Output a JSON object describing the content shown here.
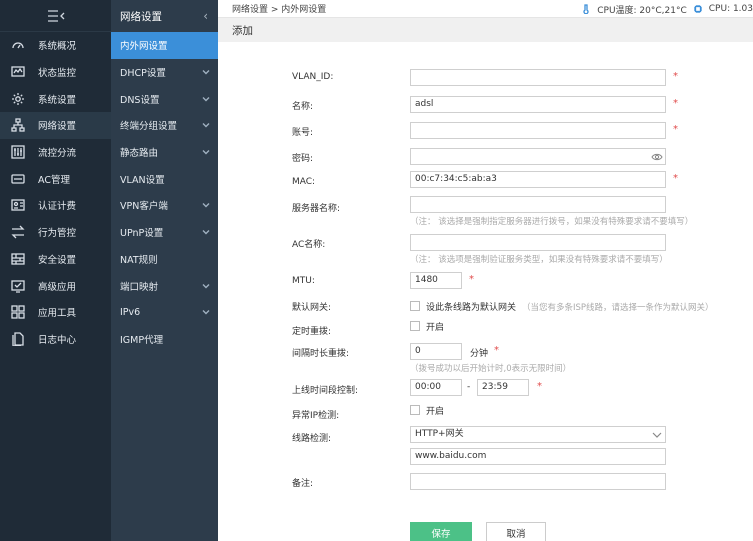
{
  "nav_primary": {
    "items": [
      {
        "label": "系统概况",
        "icon": "gauge-icon"
      },
      {
        "label": "状态监控",
        "icon": "monitor-icon"
      },
      {
        "label": "系统设置",
        "icon": "gear-icon"
      },
      {
        "label": "网络设置",
        "icon": "network-icon"
      },
      {
        "label": "流控分流",
        "icon": "sliders-icon"
      },
      {
        "label": "AC管理",
        "icon": "router-icon"
      },
      {
        "label": "认证计费",
        "icon": "id-card-icon"
      },
      {
        "label": "行为管控",
        "icon": "arrows-icon"
      },
      {
        "label": "安全设置",
        "icon": "firewall-icon"
      },
      {
        "label": "高级应用",
        "icon": "check-screen-icon"
      },
      {
        "label": "应用工具",
        "icon": "apps-icon"
      },
      {
        "label": "日志中心",
        "icon": "document-icon"
      }
    ]
  },
  "nav_secondary": {
    "title": "网络设置",
    "items": [
      {
        "label": "内外网设置"
      },
      {
        "label": "DHCP设置"
      },
      {
        "label": "DNS设置"
      },
      {
        "label": "终端分组设置"
      },
      {
        "label": "静态路由"
      },
      {
        "label": "VLAN设置"
      },
      {
        "label": "VPN客户端"
      },
      {
        "label": "UPnP设置"
      },
      {
        "label": "NAT规则"
      },
      {
        "label": "端口映射"
      },
      {
        "label": "IPv6"
      },
      {
        "label": "IGMP代理"
      }
    ]
  },
  "topbar": {
    "breadcrumb": "网络设置 > 内外网设置",
    "cpu_temp": "CPU温度: 20°C,21°C",
    "cpu": "CPU: 1.03"
  },
  "page_title": "添加",
  "form": {
    "vlan_id": {
      "label": "VLAN_ID:",
      "value": ""
    },
    "name": {
      "label": "名称:",
      "value": "adsl"
    },
    "account": {
      "label": "账号:",
      "value": ""
    },
    "password": {
      "label": "密码:",
      "value": ""
    },
    "mac": {
      "label": "MAC:",
      "value": "00:c7:34:c5:ab:a3"
    },
    "server_name": {
      "label": "服务器名称:",
      "value": "",
      "hint": "（注： 该选择是强制指定服务器进行拨号，如果没有特殊要求请不要填写）"
    },
    "ac_name": {
      "label": "AC名称:",
      "value": "",
      "hint": "（注： 该选项是强制验证服务类型，如果没有特殊要求请不要填写）"
    },
    "mtu": {
      "label": "MTU:",
      "value": "1480"
    },
    "default_gw": {
      "label": "默认网关:",
      "text": "设此条线路为默认网关",
      "hint": "（当您有多条ISP线路，请选择一条作为默认网关）"
    },
    "timed_redial": {
      "label": "定时重拨:",
      "text": "开启"
    },
    "interval_redial": {
      "label": "间隔时长重拨:",
      "value": "0",
      "unit": "分钟",
      "hint": "（拨号成功以后开始计时,0表示无限时间）"
    },
    "online_period": {
      "label": "上线时间段控制:",
      "start": "00:00",
      "sep": "-",
      "end": "23:59"
    },
    "abnormal_ip": {
      "label": "异常IP检测:",
      "text": "开启"
    },
    "line_detect": {
      "label": "线路检测:",
      "selected": "HTTP+网关",
      "url": "www.baidu.com"
    },
    "remark": {
      "label": "备注:",
      "value": ""
    }
  },
  "buttons": {
    "save": "保存",
    "cancel": "取消"
  },
  "colors": {
    "accent": "#3b8fd9",
    "save": "#4cc187",
    "required": "#e04b4b"
  }
}
